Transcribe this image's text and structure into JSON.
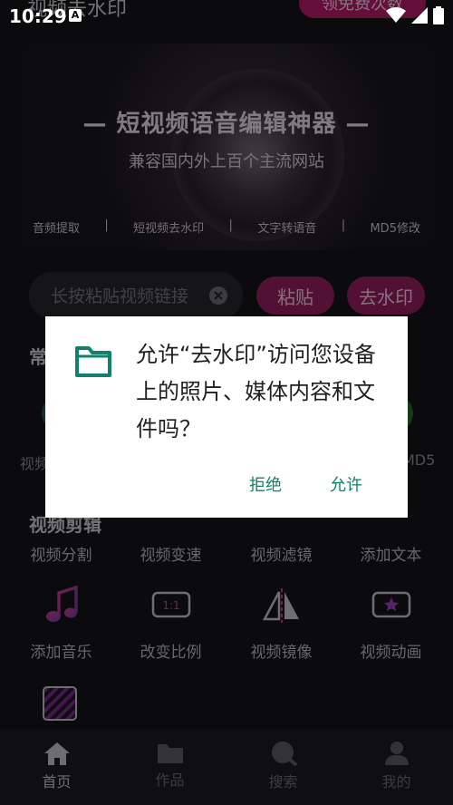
{
  "status_bar": {
    "time": "10:29",
    "notification_letter": "A"
  },
  "header": {
    "title": "视频去水印",
    "quota_button": "领免费次数"
  },
  "banner": {
    "headline": "— 短视频语音编辑神器 —",
    "subtitle": "兼容国内外上百个主流网站",
    "tags": [
      "音频提取",
      "|",
      "短视频去水印",
      "|",
      "文字转语音",
      "|",
      "MD5修改"
    ]
  },
  "search": {
    "placeholder": "长按粘贴视频链接",
    "paste_button": "粘贴",
    "remove_watermark_button": "去水印"
  },
  "common_section": {
    "title": "常",
    "partial_left_label": "视频",
    "partial_right_label": "MD5"
  },
  "video_edit": {
    "title": "视频剪辑",
    "row1": [
      "视频分割",
      "视频变速",
      "视频滤镜",
      "添加文本"
    ],
    "row2": [
      {
        "label": "添加音乐",
        "icon": "music-note-icon"
      },
      {
        "label": "改变比例",
        "icon": "aspect-ratio-icon",
        "badge": "1:1"
      },
      {
        "label": "视频镜像",
        "icon": "mirror-icon"
      },
      {
        "label": "视频动画",
        "icon": "star-box-icon"
      }
    ]
  },
  "bottom_nav": [
    {
      "label": "首页",
      "icon": "home-icon",
      "active": true
    },
    {
      "label": "作品",
      "icon": "folder-icon",
      "active": false
    },
    {
      "label": "搜索",
      "icon": "search-icon",
      "active": false
    },
    {
      "label": "我的",
      "icon": "user-icon",
      "active": false
    }
  ],
  "permission_dialog": {
    "message": "允许“去水印”访问您设备上的照片、媒体内容和文件吗？",
    "deny": "拒绝",
    "allow": "允许",
    "icon": "folder-icon"
  },
  "colors": {
    "accent": "#96205f",
    "dialog_button": "#12806b",
    "icon_gradient_start": "#d63c8c"
  }
}
